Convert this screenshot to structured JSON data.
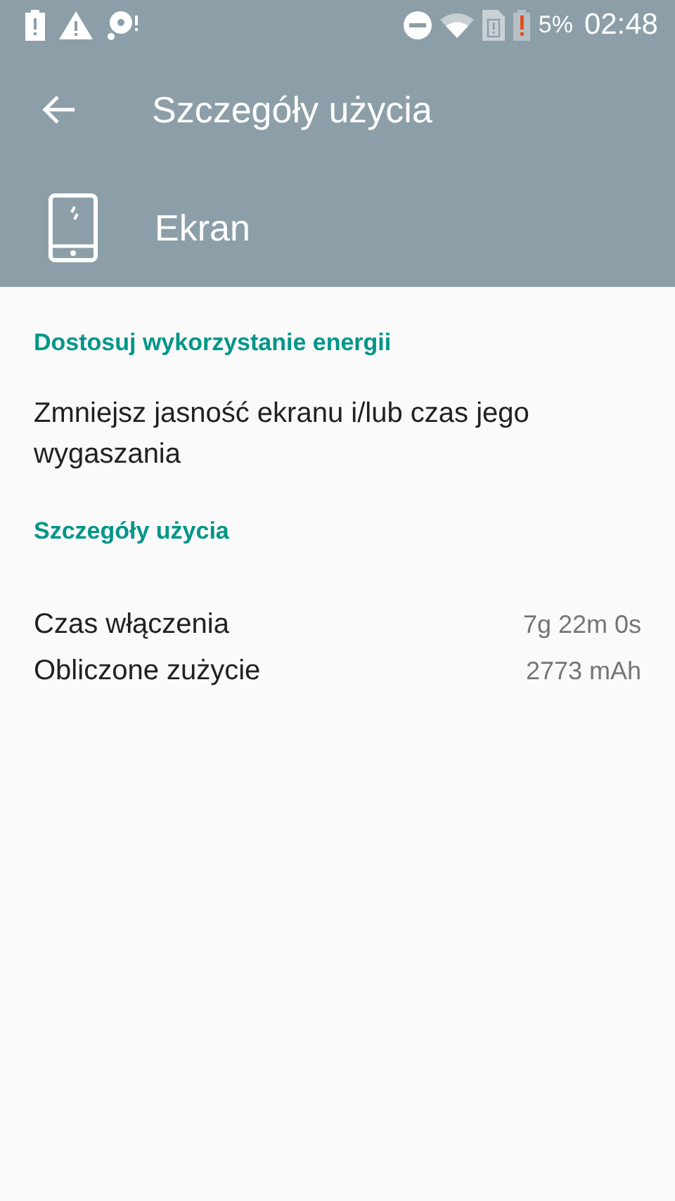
{
  "status_bar": {
    "battery_percent": "5%",
    "time": "02:48"
  },
  "toolbar": {
    "title": "Szczegóły użycia"
  },
  "app_header": {
    "name": "Ekran"
  },
  "sections": [
    {
      "kind": "hint",
      "title": "Dostosuj wykorzystanie energii",
      "text": "Zmniejsz jasność ekranu i/lub czas jego wygaszania"
    },
    {
      "kind": "details",
      "title": "Szczegóły użycia",
      "rows": [
        {
          "label": "Czas włączenia",
          "value": "7g 22m 0s"
        },
        {
          "label": "Obliczone zużycie",
          "value": "2773 mAh"
        }
      ]
    }
  ]
}
